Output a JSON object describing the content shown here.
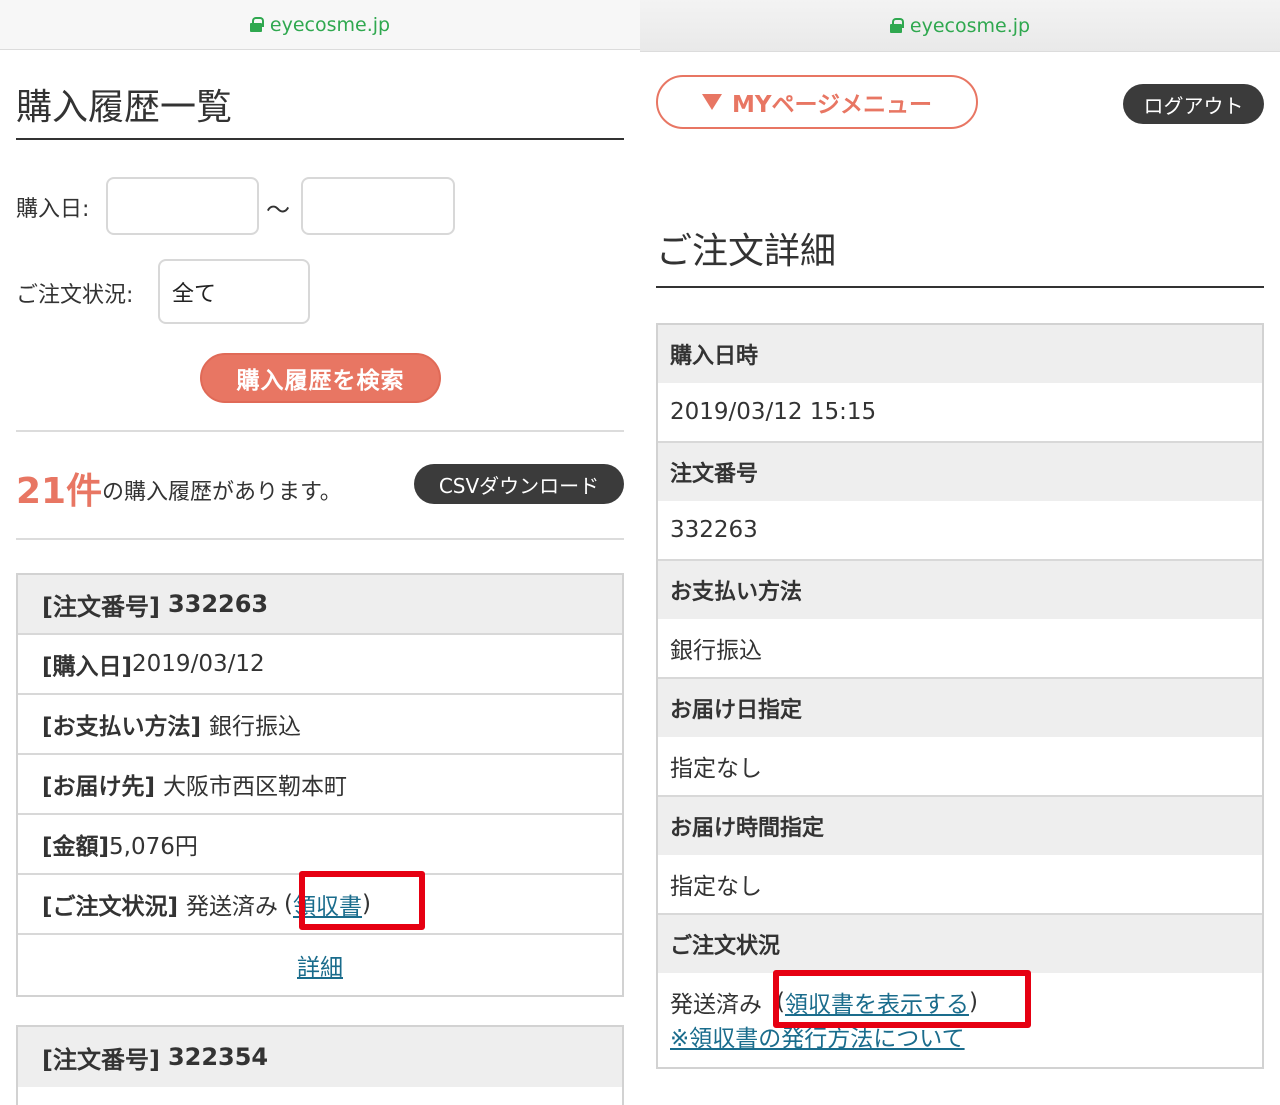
{
  "left": {
    "url": "eyecosme.jp",
    "title": "購入履歴一覧",
    "purchase_date_label": "購入日:",
    "tilde": "〜",
    "order_status_label": "ご注文状況:",
    "order_status_value": "全て",
    "search_button": "購入履歴を検索",
    "count": "21件",
    "count_suffix": "の購入履歴があります。",
    "csv_button": "CSVダウンロード",
    "orders": [
      {
        "order_number_label": "[注文番号]",
        "order_number": "332263",
        "purchase_date_label": "[購入日]",
        "purchase_date": "2019/03/12",
        "payment_label": "[お支払い方法]",
        "payment": "銀行振込",
        "delivery_label": "[お届け先]",
        "delivery": "大阪市西区靭本町",
        "amount_label": "[金額]",
        "amount": "5,076円",
        "status_label": "[ご注文状況]",
        "status": "発送済み",
        "receipt_open": "(",
        "receipt_link": "領収書",
        "receipt_close": ")",
        "detail_link": "詳細"
      },
      {
        "order_number_label": "[注文番号]",
        "order_number": "322354"
      }
    ]
  },
  "right": {
    "url": "eyecosme.jp",
    "menu_button": "MYページメニュー",
    "logout_button": "ログアウト",
    "title": "ご注文詳細",
    "fields": [
      {
        "label": "購入日時",
        "value": "2019/03/12 15:15"
      },
      {
        "label": "注文番号",
        "value": "332263"
      },
      {
        "label": "お支払い方法",
        "value": "銀行振込"
      },
      {
        "label": "お届け日指定",
        "value": "指定なし"
      },
      {
        "label": "お届け時間指定",
        "value": "指定なし"
      }
    ],
    "status_label": "ご注文状況",
    "status_value": "発送済み",
    "receipt_open": "(",
    "receipt_link": "領収書を表示する",
    "receipt_close": ")",
    "receipt_info_link": "※領収書の発行方法について"
  },
  "colors": {
    "accent": "#e87663",
    "link": "#1a6c8c",
    "highlight": "#e60012",
    "dark_button": "#3b3b3b",
    "secure": "#2fa84f"
  }
}
